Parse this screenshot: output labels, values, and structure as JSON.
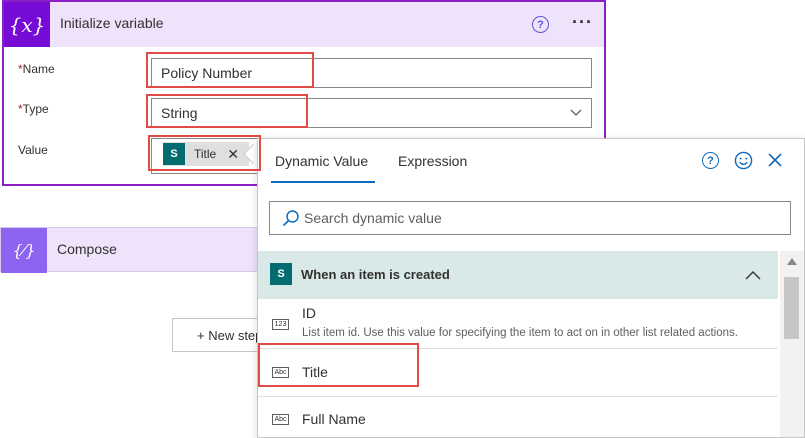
{
  "init_variable": {
    "icon_text": "{x}",
    "title": "Initialize variable",
    "help_glyph": "?",
    "more_glyph": "···",
    "name": {
      "required_mark": "*",
      "label": "Name",
      "value": "Policy Number"
    },
    "type": {
      "required_mark": "*",
      "label": "Type",
      "value": "String"
    },
    "value": {
      "label": "Value",
      "token_label": "Title",
      "token_remove": "✕"
    }
  },
  "compose": {
    "icon_text": "{⁄}",
    "title": "Compose"
  },
  "new_step_label": "+ New step",
  "dynamic_panel": {
    "tabs": [
      {
        "label": "Dynamic Value",
        "selected": true
      },
      {
        "label": "Expression",
        "selected": false
      }
    ],
    "help_glyph": "?",
    "search_placeholder": "Search dynamic value",
    "section_title": "When an item is created",
    "items": [
      {
        "icon_text": "123",
        "title": "ID",
        "description": "List item id. Use this value for specifying the item to act on in other list related actions."
      },
      {
        "icon_text": "Abc",
        "title": "Title",
        "description": ""
      },
      {
        "icon_text": "Abc",
        "title": "Full Name",
        "description": ""
      }
    ]
  },
  "colors": {
    "init_accent": "#770bd6",
    "compose_accent": "#8c64f0",
    "header_tint": "#efe2fb",
    "section_tint": "#d8e9e8",
    "sharepoint": "#036c70",
    "highlight": "#e04c45",
    "link_blue": "#0f6cbd"
  },
  "icons": [
    "variable-icon",
    "help-icon",
    "more-icon",
    "chevron-down-icon",
    "sharepoint-icon",
    "close-icon",
    "compose-icon",
    "smile-icon",
    "search-icon",
    "chevron-up-icon",
    "number-icon",
    "text-icon"
  ]
}
